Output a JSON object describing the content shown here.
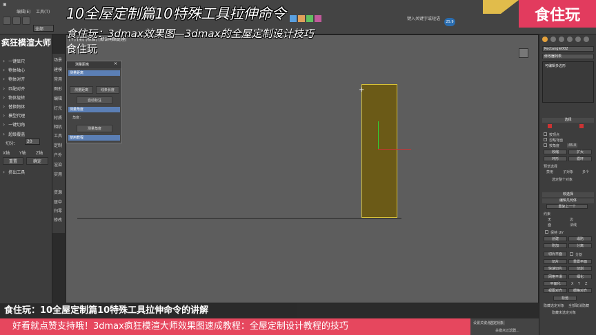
{
  "titles": {
    "line1": "10全屋定制篇10特殊工具拉伸命令",
    "line2": "食住玩：3dmax效果图—3dmax的全屋定制设计技巧",
    "line3": "食住玩"
  },
  "brand": {
    "label": "食住玩"
  },
  "toolbar": {
    "menu_items": [
      "编辑(E)",
      "工具(T)"
    ],
    "select_value": "全部",
    "help_hint": "键入关键字或短语",
    "vp_badge": "25.9"
  },
  "left_panel": {
    "title": "疯狂模渲大师",
    "items": [
      "一键显尺",
      "物体轴心",
      "物体对齐",
      "匹配对齐",
      "物体旋转",
      "替换物体",
      "模型代理",
      "一键切角",
      "超级覆盖"
    ],
    "spin_label": "切分：",
    "spin_value": "20",
    "axis_options": [
      "X轴",
      "Y轴",
      "Z轴"
    ],
    "reset_button": "重置",
    "confirm_button": "确定",
    "extra_item": "挤出工具"
  },
  "category_column": [
    "场景",
    "建模",
    "常用",
    "图形",
    "编辑",
    "灯光",
    "材质",
    "相机",
    "工具",
    "定制",
    "户外",
    "渲染",
    "实用",
    "资源",
    "居中",
    "归零",
    "修改"
  ],
  "dialog": {
    "title": "测量距离",
    "sec1": "测量距离",
    "measure_distance_button": "测量距离",
    "line_length_button": "线条长度",
    "auto_mark_button": "自动标注",
    "sec2": "测量角度",
    "angle_label": "角度：",
    "measure_angle_button": "测量角度",
    "sec3": "使用教程"
  },
  "viewport": {
    "label": "[+] [前] [标准] [默认明暗处理]"
  },
  "right_panel": {
    "object_name": "Rectangle002",
    "modifier_list": "修改器列表",
    "stack_item": "可编辑多边形",
    "selection_header": "选择",
    "opt_by_vertex": "按顶点",
    "opt_ignore_back": "忽略背面",
    "opt_by_angle": "按角度",
    "angle_value": "45.0",
    "btn_shrink": "收缩",
    "btn_grow": "扩大",
    "btn_ring": "环形",
    "btn_loop": "循环",
    "preview_header": "预览选择",
    "preview_opts": [
      "禁用",
      "子对象",
      "多个"
    ],
    "selected_count": "选定整个对象",
    "soft_sel_header": "软选择",
    "edit_geom_header": "编辑几何体",
    "repeat_last": "重复上一个",
    "constraint_label": "约束",
    "constraint_opts": [
      "无",
      "边",
      "面",
      "法线"
    ],
    "preserve_uv": "保持 UV",
    "btn_create": "创建",
    "btn_collapse": "塌陷",
    "btn_attach": "附加",
    "btn_detach": "分离",
    "btn_slice_plane": "切片平面",
    "btn_split": "分割",
    "btn_slice": "切片",
    "btn_reset_plane": "重置平面",
    "btn_quickslice": "快速切片",
    "btn_cut": "切割",
    "btn_meshsmooth": "网格平滑",
    "btn_tessellate": "细化",
    "btn_planarize": "平面化",
    "axes": [
      "X",
      "Y",
      "Z"
    ],
    "btn_view_align": "视图对齐",
    "btn_grid_align": "栅格对齐",
    "btn_relax": "松弛",
    "hide_selected": "隐藏选定对象",
    "unhide_all": "全部取消隐藏",
    "hide_unselected": "隐藏未选定对象"
  },
  "status": {
    "select_label": "选定对象",
    "set_key": "设置关键点",
    "key_filter": "关键点过滤器..."
  },
  "subtitles": {
    "line1": "食住玩：10全屋定制篇10特殊工具拉伸命令的讲解",
    "line2": "好看就点赞支持哦！3dmax疯狂模渲大师效果图速成教程：全屋定制设计教程的技巧"
  }
}
